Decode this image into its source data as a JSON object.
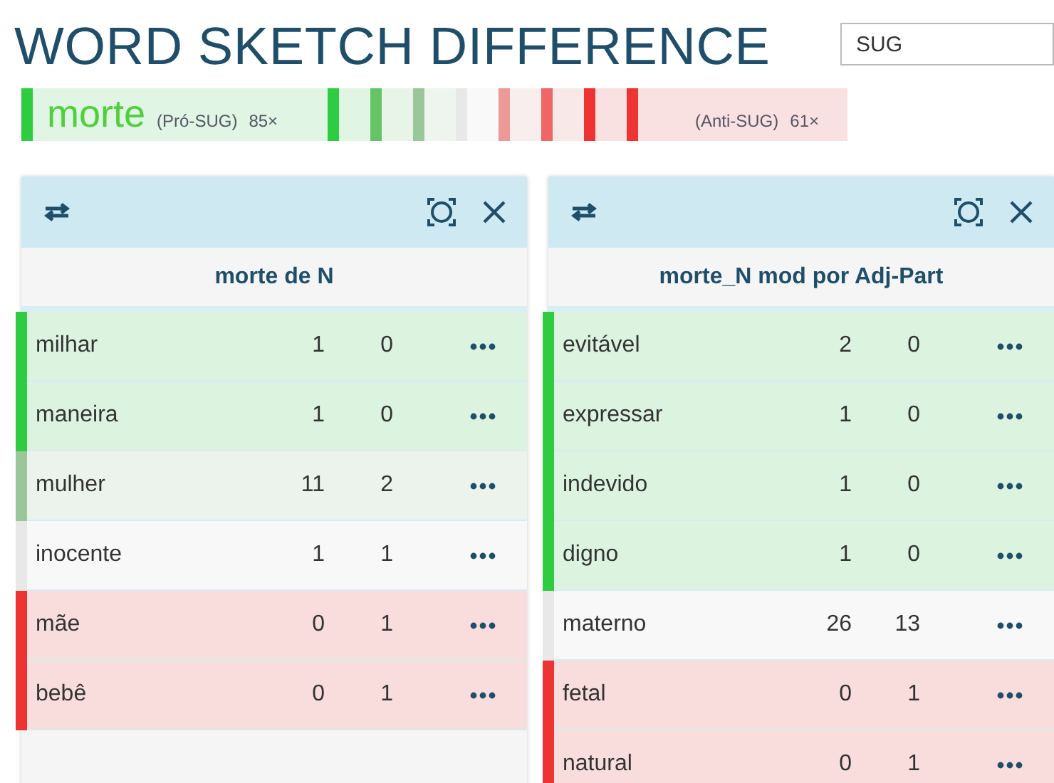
{
  "title": "WORD SKETCH DIFFERENCE",
  "search": {
    "value": "SUG"
  },
  "legend": {
    "word": "morte",
    "pro_label": "(Pró-SUG)",
    "pro_count": "85×",
    "anti_label": "(Anti-SUG)",
    "anti_count": "61×",
    "scale": [
      {
        "color": "#2ecc40"
      },
      {
        "color": "#2ecc40"
      },
      {
        "color": "#66c466"
      },
      {
        "color": "#99c799"
      },
      {
        "color": "#e8e8e8"
      },
      {
        "color": "#ee9999"
      },
      {
        "color": "#ee6666"
      },
      {
        "color": "#ee3333"
      },
      {
        "color": "#ee3333"
      }
    ]
  },
  "panels": [
    {
      "title": "morte de N",
      "rows": [
        {
          "word": "milhar",
          "a": "1",
          "b": "0",
          "color": "#2ecc40"
        },
        {
          "word": "maneira",
          "a": "1",
          "b": "0",
          "color": "#2ecc40"
        },
        {
          "word": "mulher",
          "a": "11",
          "b": "2",
          "color": "#99c799"
        },
        {
          "word": "inocente",
          "a": "1",
          "b": "1",
          "color": "#e8e8e8"
        },
        {
          "word": "mãe",
          "a": "0",
          "b": "1",
          "color": "#ee3333"
        },
        {
          "word": "bebê",
          "a": "0",
          "b": "1",
          "color": "#ee3333"
        }
      ]
    },
    {
      "title": "morte_N mod por Adj-Part",
      "rows": [
        {
          "word": "evitável",
          "a": "2",
          "b": "0",
          "color": "#2ecc40"
        },
        {
          "word": "expressar",
          "a": "1",
          "b": "0",
          "color": "#2ecc40"
        },
        {
          "word": "indevido",
          "a": "1",
          "b": "0",
          "color": "#2ecc40"
        },
        {
          "word": "digno",
          "a": "1",
          "b": "0",
          "color": "#2ecc40"
        },
        {
          "word": "materno",
          "a": "26",
          "b": "13",
          "color": "#e8e8e8"
        },
        {
          "word": "fetal",
          "a": "0",
          "b": "1",
          "color": "#ee3333"
        },
        {
          "word": "natural",
          "a": "0",
          "b": "1",
          "color": "#ee3333"
        }
      ]
    }
  ]
}
